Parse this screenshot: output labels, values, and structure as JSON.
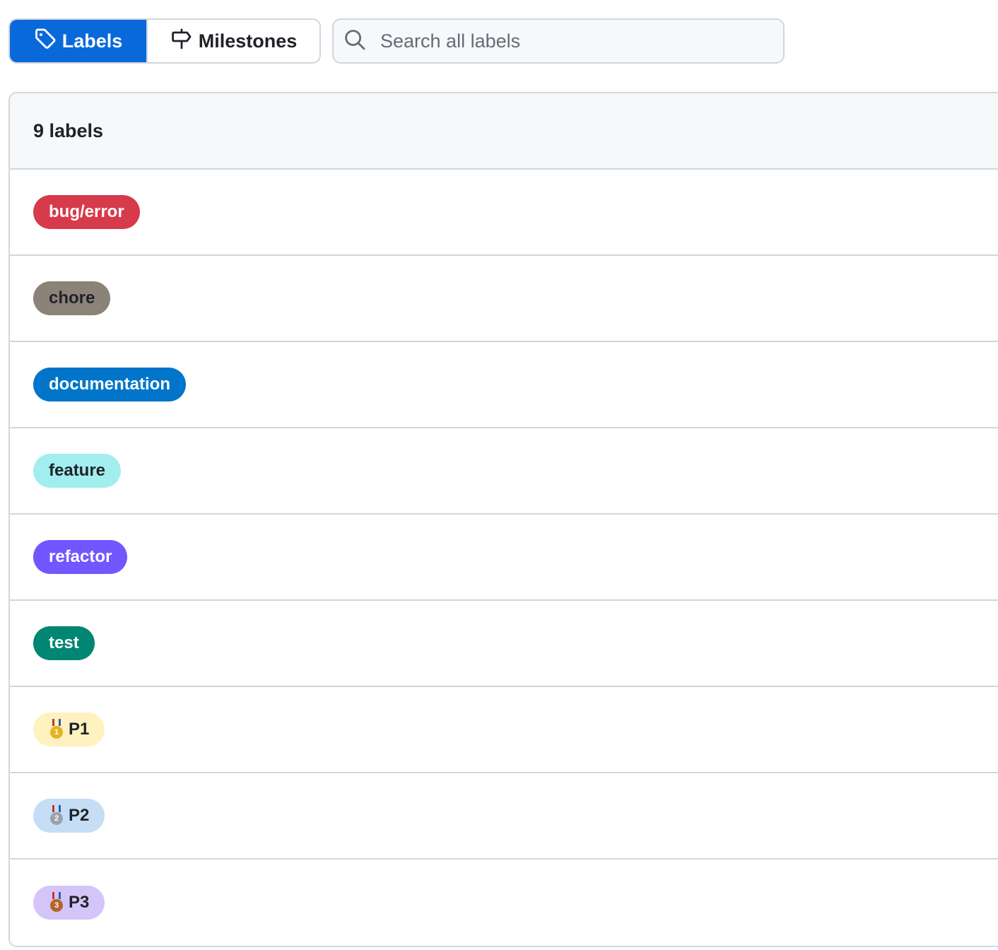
{
  "subnav": {
    "labels_tab": "Labels",
    "milestones_tab": "Milestones"
  },
  "search": {
    "placeholder": "Search all labels"
  },
  "list": {
    "count_text": "9 labels",
    "labels": [
      {
        "name": "bug/error",
        "bg": "#d73a4a",
        "fg": "#ffffff"
      },
      {
        "name": "chore",
        "bg": "#8b8278",
        "fg": "#1f2328"
      },
      {
        "name": "documentation",
        "bg": "#0075ca",
        "fg": "#ffffff"
      },
      {
        "name": "feature",
        "bg": "#a2eeef",
        "fg": "#1f2328"
      },
      {
        "name": "refactor",
        "bg": "#7057ff",
        "fg": "#ffffff"
      },
      {
        "name": "test",
        "bg": "#008672",
        "fg": "#ffffff"
      },
      {
        "name": "P1",
        "bg": "#fef2c0",
        "fg": "#1f2328",
        "icon": "gold-medal-icon",
        "medal_num": "1",
        "medal_color": "#e6b422"
      },
      {
        "name": "P2",
        "bg": "#c5def5",
        "fg": "#1f2328",
        "icon": "silver-medal-icon",
        "medal_num": "2",
        "medal_color": "#9aa3ad"
      },
      {
        "name": "P3",
        "bg": "#d4c5f9",
        "fg": "#1f2328",
        "icon": "bronze-medal-icon",
        "medal_num": "3",
        "medal_color": "#b5652b"
      }
    ]
  },
  "colors": {
    "accent": "#0969da",
    "border": "#d0d7de",
    "header_bg": "#f6f8fa"
  }
}
